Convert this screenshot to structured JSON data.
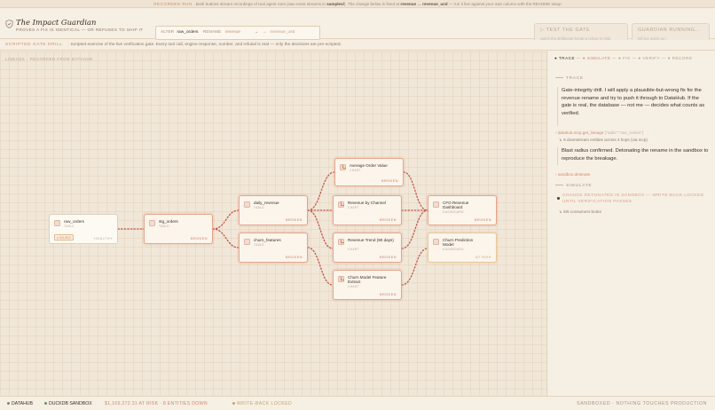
{
  "topbar": {
    "label": "RECORDED RUN",
    "text_a": " · Both buttons stream recordings of real agent runs (raw event streams in ",
    "text_b": "samples/",
    "text_c": "). The change below is fixed at ",
    "text_d": "revenue → revenue_usd",
    "text_e": " — run it live against your own column with the README setup"
  },
  "header": {
    "title": "The Impact Guardian",
    "subtitle": "PROVES A FIX IS IDENTICAL — OR REFUSES TO SHIP IT"
  },
  "alter": {
    "kw_alter": "ALTER",
    "table": "raw_orders",
    "kw_rename": "RENAME",
    "from_col": "revenue",
    "arrow": "→",
    "to_col": "revenue_usd"
  },
  "buttons": {
    "gate_title": "TEST THE GATE",
    "gate_sub": "watch the deliberate break & refuse to ship",
    "guardian_title": "GUARDIAN RUNNING…",
    "guardian_sub": "full live agent run"
  },
  "drill": {
    "label": "SCRIPTED GATE DRILL",
    "text": "· Scripted exercise of the live verification gate. Every tool call, engine response, number, and refusal is real — only the decisions are pre-scripted."
  },
  "canvas": {
    "label": "LINEAGE · RECORDED FROM DATAHUB"
  },
  "nodes": {
    "raw_orders": {
      "name": "raw_orders",
      "type": "TABLE",
      "status": "HEALTHY",
      "tag": "● SOURCE"
    },
    "stg_orders": {
      "name": "stg_orders",
      "type": "TABLE",
      "status": "BROKEN"
    },
    "daily_revenue": {
      "name": "daily_revenue",
      "type": "TABLE",
      "status": "BROKEN"
    },
    "churn_features": {
      "name": "churn_features",
      "type": "TABLE",
      "status": "BROKEN"
    },
    "aov": {
      "name": "Average Order Value",
      "type": "CHART",
      "status": "BROKEN"
    },
    "rev_channel": {
      "name": "Revenue by Channel",
      "type": "CHART",
      "status": "BROKEN"
    },
    "rev_trend": {
      "name": "Revenue Trend (90 days)",
      "type": "CHART",
      "status": "BROKEN"
    },
    "churn_extract": {
      "name": "Churn Model Feature Extract",
      "type": "CHART",
      "status": "BROKEN"
    },
    "cfo": {
      "name": "CFO Revenue Dashboard",
      "type": "DASHBOARD",
      "status": "BROKEN"
    },
    "churn_pred": {
      "name": "Churn Prediction Model",
      "type": "DASHBOARD",
      "status": "AT RISK"
    }
  },
  "panel": {
    "steps": {
      "trace": "● TRACE",
      "simulate": "● SIMULATE",
      "fix": "● FIX",
      "verify": "● VERIFY",
      "record": "● RECORD"
    },
    "trace_heading": "TRACE",
    "msg1": "Gate-integrity drill. I will apply a plausible-but-wrong fix for the revenue rename and try to push it through to DataHub. If the gate is real, the database — not me — decides what counts as verified.",
    "tool1": "datahub.mcp.get_lineage",
    "tool1_args": "{\"table\":\"raw_orders\"}",
    "result1": "9 downstream entities across 4 hops (via mcp)",
    "msg2": "Blast radius confirmed. Detonating the rename in the sandbox to reproduce the breakage.",
    "tool2": "sandbox.detonate",
    "simulate_heading": "SIMULATE",
    "sim_text": "CHANGE DETONATED IN SANDBOX — WRITE-BACK LOCKED UNTIL VERIFICATION PASSES",
    "sim_result": "6/6 consumers broke"
  },
  "footer": {
    "datahub": "DATAHUB",
    "duckdb": "DUCKDB SANDBOX",
    "risk": "$1,169,272.31 AT RISK · 8 ENTITIES DOWN",
    "lock": "WRITE-BACK LOCKED",
    "sandboxed": "SANDBOXED · NOTHING TOUCHES PRODUCTION"
  },
  "colors": {
    "accent": "#d08a6a",
    "broken": "#c97a5e",
    "at_risk": "#c9a468",
    "edge": "#c0584a",
    "healthy_dot": "#6f8f5e"
  }
}
